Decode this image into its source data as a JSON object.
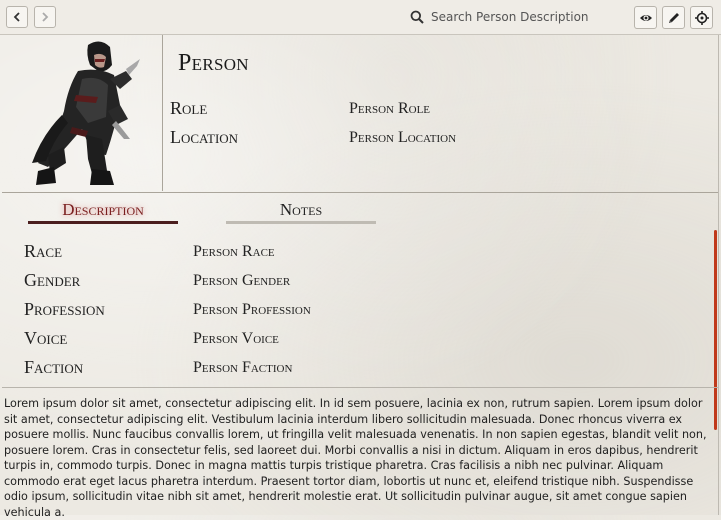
{
  "toolbar": {
    "back_icon": "chevron-left-icon",
    "forward_icon": "chevron-right-icon",
    "search_icon": "search-icon",
    "search_placeholder": "Search Person Description",
    "view_icon": "eye-icon",
    "edit_icon": "pencil-icon",
    "locate_icon": "crosshair-icon"
  },
  "header": {
    "title": "Person",
    "fields": [
      {
        "label": "Role",
        "value": "Person Role"
      },
      {
        "label": "Location",
        "value": "Person Location"
      }
    ]
  },
  "tabs": [
    {
      "label": "Description",
      "active": true
    },
    {
      "label": "Notes",
      "active": false
    }
  ],
  "attributes": [
    {
      "label": "Race",
      "value": "Person Race"
    },
    {
      "label": "Gender",
      "value": "Person Gender"
    },
    {
      "label": "Profession",
      "value": "Person Profession"
    },
    {
      "label": "Voice",
      "value": "Person Voice"
    },
    {
      "label": "Faction",
      "value": "Person Faction"
    }
  ],
  "description_text": "Lorem ipsum dolor sit amet, consectetur adipiscing elit. In id sem posuere, lacinia ex non, rutrum sapien. Lorem ipsum dolor sit amet, consectetur adipiscing elit. Vestibulum lacinia interdum libero sollicitudin malesuada. Donec rhoncus viverra ex posuere mollis. Nunc faucibus convallis lorem, ut fringilla velit malesuada venenatis. In non sapien egestas, blandit velit non, posuere lorem. Cras in consectetur felis, sed laoreet dui. Morbi convallis a nisi in dictum. Aliquam in eros dapibus, hendrerit turpis in, commodo turpis. Donec in magna mattis turpis tristique pharetra. Cras facilisis a nibh nec pulvinar. Aliquam commodo erat eget lacus pharetra interdum. Praesent tortor diam, lobortis ut nunc et, eleifend tristique nibh. Suspendisse odio ipsum, sollicitudin vitae nibh sit amet, hendrerit molestie erat. Ut sollicitudin pulvinar augue, sit amet congue sapien vehicula a.",
  "colors": {
    "accent_tab": "#7a1f1f",
    "tab_underline_active": "#4b1e1e",
    "scroll_indicator": "#c0391b",
    "background": "#ece9e2"
  }
}
